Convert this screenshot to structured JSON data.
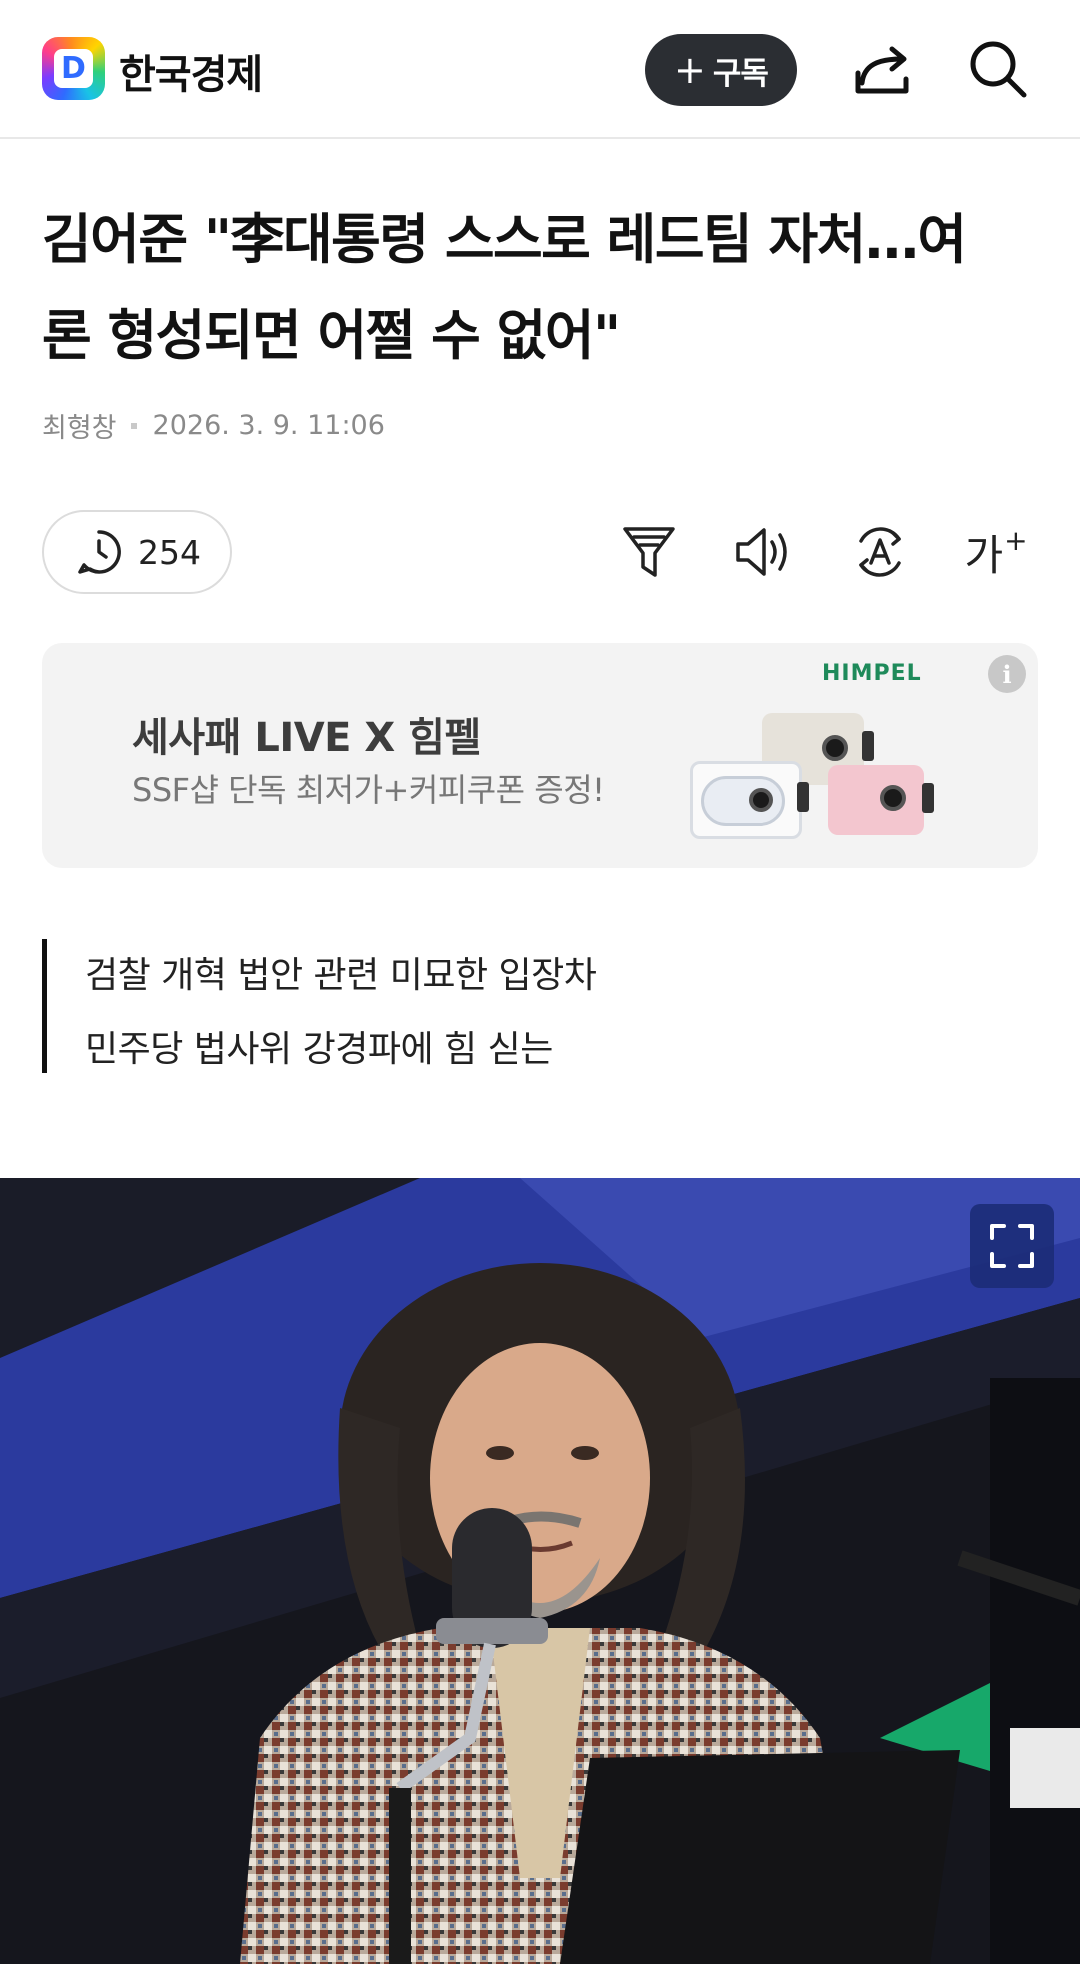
{
  "header": {
    "logo_letter": "D",
    "brand": "한국경제",
    "subscribe_plus": "+",
    "subscribe_label": "구독",
    "share_icon": "share-icon",
    "search_icon": "search-icon"
  },
  "article": {
    "title_line1": "김어준 \"李대통령 스스로 레드팀 자처…여",
    "title_line2": "론 형성되면 어쩔 수 없어\"",
    "author": "최형창",
    "datetime": "2026. 3. 9. 11:06"
  },
  "toolbar": {
    "comment_count": "254",
    "font_size_label": "가",
    "font_size_plus": "+"
  },
  "ad": {
    "title": "세사패 LIVE X 힘펠",
    "subtitle": "SSF샵 단독 최저가+커피쿠폰 증정!",
    "brand": "HIMPEL",
    "info": "i"
  },
  "summary": {
    "lines": [
      "검찰 개혁 법안 관련 미묘한 입장차",
      "민주당 법사위 강경파에 힘 싣는"
    ]
  },
  "colors": {
    "subscribe_bg": "#2b2e33",
    "ad_bg": "#f3f3f3",
    "ad_brand": "#1e8a5a",
    "photo_accent": "#2b3a9e"
  }
}
